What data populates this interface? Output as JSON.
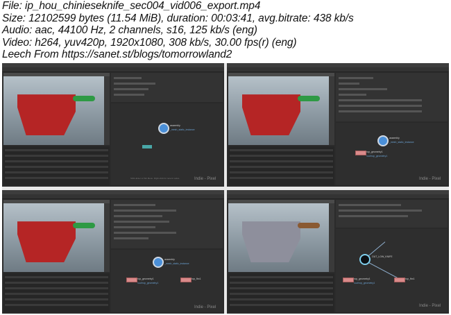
{
  "header": {
    "file_line": "File: ip_hou_chinieseknife_sec004_vid006_export.mp4",
    "size_line": "Size: 12102599 bytes (11.54 MiB), duration: 00:03:41, avg.bitrate: 438 kb/s",
    "audio_line": "Audio: aac, 44100 Hz, 2 channels, s16, 125 kb/s (eng)",
    "video_line": "Video: h264, yuv420p, 1920x1080, 308 kb/s, 30.00 fps(r) (eng)",
    "leech_line": "Leech From https://sanet.st/blogs/tomorrowland2"
  },
  "thumbs": [
    {
      "node_main": "assembly",
      "node_main_sub": "_mesh_static_instance",
      "hint": "Shift+Enter to Tab Menu. Right-click for recent nodes.",
      "watermark": "Indie - Pixel"
    },
    {
      "node_main": "assembly",
      "node_main_sub": "_mesh_static_instance",
      "node_geo": "rop_geometry1",
      "node_geo_sub": "/out/rop_geometry1",
      "watermark": "Indie - Pixel"
    },
    {
      "node_main": "assembly",
      "node_main_sub": "_mesh_static_instance",
      "node_geo": "rop_geometry1",
      "node_geo_sub": "/out/rop_geometry1",
      "node_fbx": "rop_fbx1",
      "watermark": "Indie - Pixel"
    },
    {
      "node_main": "OUT_LOW_KNIFE",
      "node_geo": "rop_geometry1",
      "node_geo_sub": "/out/rop_geometry1",
      "node_fbx": "rop_fbx1",
      "watermark": "Indie - Pixel"
    }
  ],
  "colors": {
    "blade_red": "#b52525",
    "blade_grey": "#8e8f9c",
    "handle_green": "#2e9a44",
    "handle_brown": "#8a5a32",
    "node_blue": "#4a8fd8",
    "node_pink": "#d98a8a"
  }
}
